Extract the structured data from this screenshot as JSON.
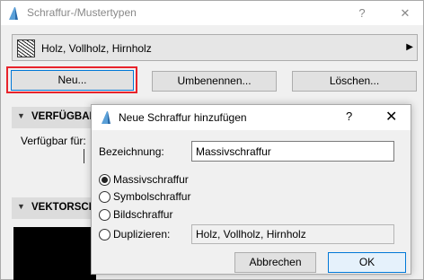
{
  "parent_window": {
    "title": "Schraffur-/Mustertypen",
    "help_label": "?",
    "close_label": "✕",
    "pattern_select": {
      "value": "Holz, Vollholz, Hirnholz",
      "arrow": "▶"
    },
    "buttons": {
      "new": "Neu...",
      "rename": "Umbenennen...",
      "delete": "Löschen..."
    },
    "sections": {
      "availability": {
        "title": "VERFÜGBARK",
        "label": "Verfügbar für:"
      },
      "vector": {
        "title": "VEKTORSCHR"
      }
    },
    "highlight_color": "#e8232b"
  },
  "dialog": {
    "title": "Neue Schraffur hinzufügen",
    "help_label": "?",
    "close_label": "✕",
    "name_label": "Bezeichnung:",
    "name_value": "Massivschraffur",
    "options": [
      {
        "label": "Massivschraffur",
        "checked": true
      },
      {
        "label": "Symbolschraffur",
        "checked": false
      },
      {
        "label": "Bildschraffur",
        "checked": false
      },
      {
        "label": "Duplizieren:",
        "checked": false
      }
    ],
    "duplicate_source": "Holz, Vollholz, Hirnholz",
    "cancel_label": "Abbrechen",
    "ok_label": "OK",
    "accent_color": "#0078d7"
  }
}
